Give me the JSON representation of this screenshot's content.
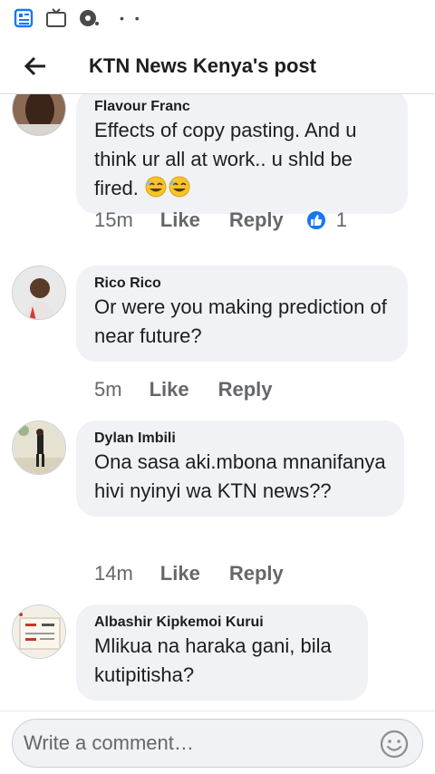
{
  "status_bar": {
    "icons": [
      "news-feed-icon",
      "tv-icon",
      "chat-bubble-icon"
    ],
    "dots": "• •"
  },
  "header": {
    "title": "KTN News Kenya's post"
  },
  "comments": [
    {
      "author": "Flavour Franc",
      "text": "Effects of copy pasting.  And u think ur all at work.. u shld be fired.",
      "emojis": [
        "rolling-laughing-emoji",
        "rolling-laughing-emoji"
      ],
      "time": "15m",
      "like_label": "Like",
      "reply_label": "Reply",
      "reaction_count": "1"
    },
    {
      "author": "Rico Rico",
      "text": "Or were you making prediction of near future?",
      "time": "5m",
      "like_label": "Like",
      "reply_label": "Reply"
    },
    {
      "author": "Dylan Imbili",
      "text": "Ona sasa aki.mbona mnanifanya hivi nyinyi wa KTN news??",
      "time": "14m",
      "like_label": "Like",
      "reply_label": "Reply"
    },
    {
      "author": "Albashir Kipkemoi Kurui",
      "text": "Mlikua na haraka gani, bila kutipitisha?"
    }
  ],
  "composer": {
    "placeholder": "Write a comment…"
  },
  "colors": {
    "accent": "#1877f2",
    "bubble": "#f0f2f5",
    "meta_text": "#65676b"
  }
}
